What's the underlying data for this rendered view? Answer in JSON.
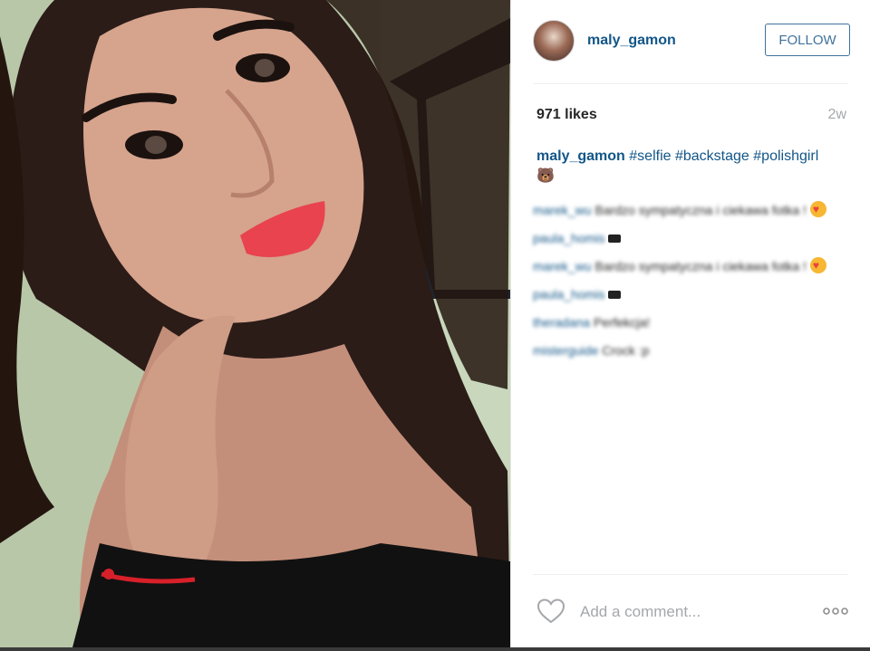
{
  "post": {
    "username": "maly_gamon",
    "follow_label": "FOLLOW",
    "likes": "971 likes",
    "age": "2w",
    "caption": {
      "user": "maly_gamon",
      "tag1": "#selfie",
      "tag2": "#backstage",
      "tag3": "#polishgirl",
      "emoji": "🐻"
    },
    "comments": [
      {
        "user": "marek_wu",
        "text": "Bardzo sympatyczna i ciekawa fotka !",
        "emoji": "heart-eyes"
      },
      {
        "user": "paula_homis",
        "text": "",
        "emoji": "sunglasses"
      },
      {
        "user": "marek_wu",
        "text": "Bardzo sympatyczna i ciekawa fotka !",
        "emoji": "heart-eyes"
      },
      {
        "user": "paula_homis",
        "text": "",
        "emoji": "sunglasses"
      },
      {
        "user": "theradana",
        "text": "Perfekcja!",
        "emoji": ""
      },
      {
        "user": "misterguide",
        "text": "Crock :p",
        "emoji": ""
      }
    ],
    "add_comment_placeholder": "Add a comment..."
  },
  "icons": {
    "like": "heart-outline-icon",
    "more": "ellipsis-icon"
  },
  "colors": {
    "link": "#125688",
    "follow": "#3f729b",
    "muted": "#a5a7aa",
    "lipstick": "#e8434f"
  }
}
